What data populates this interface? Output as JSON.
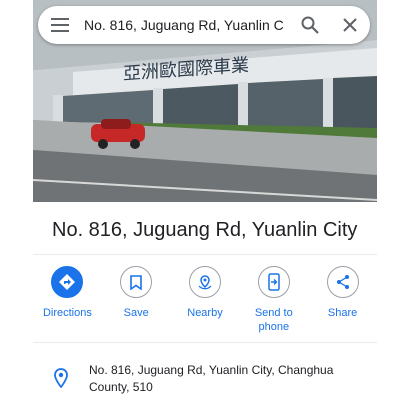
{
  "search": {
    "query": "No. 816, Juguang Rd, Yuanlin C",
    "menu_icon": "menu-icon",
    "search_icon": "search-icon",
    "close_icon": "close-icon"
  },
  "photo": {
    "storefront_sign": "亞洲歐國際車業"
  },
  "place": {
    "title": "No. 816, Juguang Rd, Yuanlin City",
    "address": "No. 816, Juguang Rd, Yuanlin City, Changhua County, 510"
  },
  "actions": [
    {
      "label": "Directions",
      "icon": "directions-icon"
    },
    {
      "label": "Save",
      "icon": "bookmark-icon"
    },
    {
      "label": "Nearby",
      "icon": "nearby-icon"
    },
    {
      "label": "Send to phone",
      "icon": "send-to-phone-icon"
    },
    {
      "label": "Share",
      "icon": "share-icon"
    }
  ],
  "colors": {
    "accent": "#1a73e8",
    "text": "#202124",
    "divider": "#e8eaed"
  }
}
